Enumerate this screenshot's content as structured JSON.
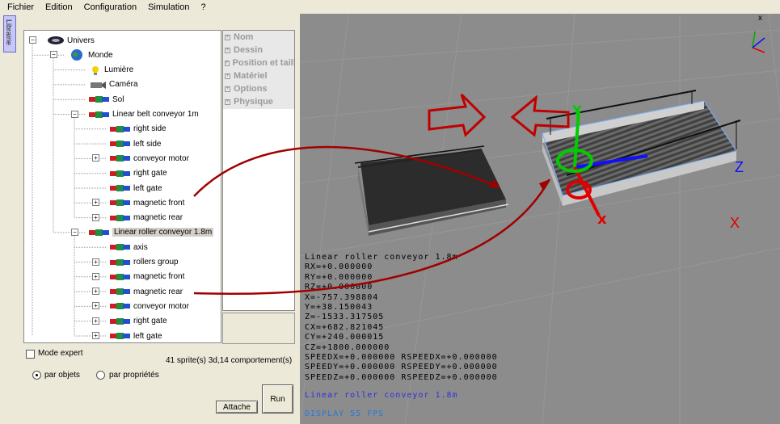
{
  "menu": [
    "Fichier",
    "Edition",
    "Configuration",
    "Simulation",
    "?"
  ],
  "sidebar_tab": "Librairie",
  "tree": [
    {
      "label": "Univers",
      "indent": 0,
      "expander": "−",
      "icon": "galaxy-icon"
    },
    {
      "label": "Monde",
      "indent": 1,
      "expander": "−",
      "icon": "globe-icon"
    },
    {
      "label": "Lumière",
      "indent": 2,
      "expander": "",
      "icon": "light-bulb-icon"
    },
    {
      "label": "Caméra",
      "indent": 2,
      "expander": "",
      "icon": "camera-icon"
    },
    {
      "label": "Sol",
      "indent": 2,
      "expander": "",
      "icon": "object-icon"
    },
    {
      "label": "Linear belt conveyor 1m",
      "indent": 2,
      "expander": "−",
      "icon": "object-icon"
    },
    {
      "label": "right side",
      "indent": 3,
      "expander": "",
      "icon": "object-icon"
    },
    {
      "label": "left side",
      "indent": 3,
      "expander": "",
      "icon": "object-icon"
    },
    {
      "label": "conveyor motor",
      "indent": 3,
      "expander": "+",
      "icon": "object-icon"
    },
    {
      "label": "right gate",
      "indent": 3,
      "expander": "",
      "icon": "object-icon"
    },
    {
      "label": "left gate",
      "indent": 3,
      "expander": "",
      "icon": "object-icon"
    },
    {
      "label": "magnetic front",
      "indent": 3,
      "expander": "+",
      "icon": "object-icon"
    },
    {
      "label": "magnetic rear",
      "indent": 3,
      "expander": "+",
      "icon": "object-icon"
    },
    {
      "label": "Linear roller conveyor 1.8m",
      "indent": 2,
      "expander": "−",
      "icon": "object-icon",
      "selected": true
    },
    {
      "label": "axis",
      "indent": 3,
      "expander": "",
      "icon": "object-icon"
    },
    {
      "label": "rollers group",
      "indent": 3,
      "expander": "+",
      "icon": "object-icon"
    },
    {
      "label": "magnetic front",
      "indent": 3,
      "expander": "+",
      "icon": "object-icon"
    },
    {
      "label": "magnetic rear",
      "indent": 3,
      "expander": "+",
      "icon": "object-icon"
    },
    {
      "label": "conveyor motor",
      "indent": 3,
      "expander": "+",
      "icon": "object-icon"
    },
    {
      "label": "right gate",
      "indent": 3,
      "expander": "+",
      "icon": "object-icon"
    },
    {
      "label": "left gate",
      "indent": 3,
      "expander": "+",
      "icon": "object-icon"
    }
  ],
  "properties": [
    "Nom",
    "Dessin",
    "Position et taill",
    "Matériel",
    "Options",
    "Physique"
  ],
  "controls": {
    "mode_expert": "Mode expert",
    "count": "41 sprite(s) 3d,14 comportement(s)",
    "par_objets": "par objets",
    "par_proprietes": "par propriétés",
    "attache": "Attache",
    "run": "Run"
  },
  "hud": [
    "Linear roller conveyor 1.8m",
    "RX=+0.000000",
    "RY=+0.000000",
    "RZ=+0.000000",
    "X=-757.398804",
    "Y=+38.150043",
    "Z=-1533.317505",
    "CX=+682.821045",
    "CY=+240.000015",
    "CZ=+1800.000000",
    "SPEEDX=+0.000000 RSPEEDX=+0.000000",
    "SPEEDY=+0.000000 RSPEEDY=+0.000000",
    "SPEEDZ=+0.000000 RSPEEDZ=+0.000000"
  ],
  "hud_selected": "Linear roller conveyor 1.8m",
  "hud_fps": "DISPLAY 55 FPS",
  "axis_labels": {
    "x": "X",
    "y": "Y",
    "z": "Z"
  },
  "colors": {
    "accent_red": "#c00000",
    "gizmo_green": "#00cc00",
    "gizmo_blue": "#1010ff"
  }
}
